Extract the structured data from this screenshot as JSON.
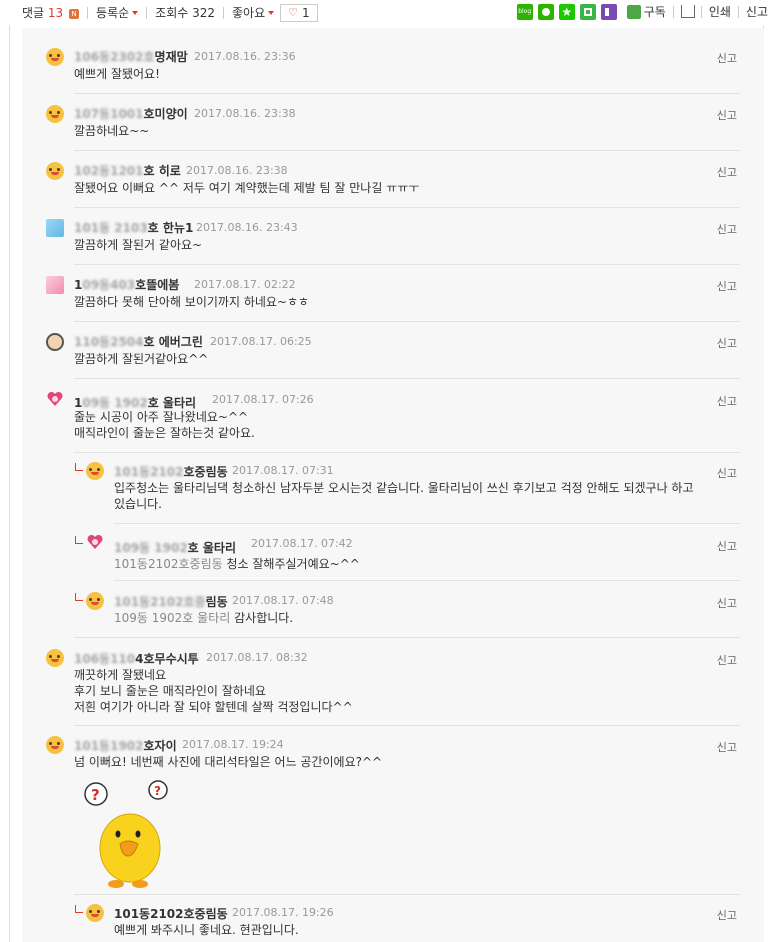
{
  "toolbar": {
    "comments_label": "댓글",
    "comments_count": "13",
    "comments_badge": "N",
    "sort_label": "등록순",
    "views_label": "조회수 322",
    "like_label": "좋아요",
    "like_count": "1",
    "subscribe_label": "구독",
    "print_label": "인쇄",
    "report_label": "신고",
    "share_icons": [
      "blog-icon",
      "band-icon",
      "star-icon",
      "square-icon",
      "pin-icon"
    ]
  },
  "comments": [
    {
      "name_blur": "106동2302호",
      "name": "명재맘",
      "date": "2017.08.16. 23:36",
      "report": "신고",
      "lines": [
        "예쁘게 잘됐어요!"
      ]
    },
    {
      "name_blur": "107동1001",
      "name": "호미양이",
      "date": "2017.08.16. 23:38",
      "report": "신고",
      "lines": [
        "깔끔하네요~~"
      ]
    },
    {
      "name_blur": "102동1201",
      "name": "호 히로",
      "date": "2017.08.16. 23:38",
      "report": "신고",
      "lines": [
        "잘됐어요 이뻐요 ^^ 저두 여기 계약했는데 제발 팀 잘 만나길 ㅠㅠㅜ"
      ]
    },
    {
      "name_blur": "101동 2103",
      "name": "호 한뉴1",
      "date": "2017.08.16. 23:43",
      "report": "신고",
      "lines": [
        "깔끔하게 잘된거 같아요~"
      ]
    },
    {
      "name_blur": "1",
      "name_blur2": "09동403",
      "name": "호뜰에봄",
      "date": "2017.08.17. 02:22",
      "report": "신고",
      "lines": [
        "깔끔하다 못해 단아해 보이기까지 하네요~ㅎㅎ"
      ]
    },
    {
      "name_blur": "110동2504",
      "name": "호 에버그린",
      "date": "2017.08.17. 06:25",
      "report": "신고",
      "lines": [
        "깔끔하게 잘된거같아요^^"
      ]
    },
    {
      "name_blur": "1",
      "name_blur2": "09동 1902",
      "name": "호 울타리",
      "date": "2017.08.17. 07:26",
      "report": "신고",
      "lines": [
        "줄눈 시공이 아주 잘나왔네요~^^",
        "매직라인이 줄눈은 잘하는것 같아요."
      ]
    },
    {
      "name_blur": "101동2102",
      "name": "호중림동",
      "date": "2017.08.17. 07:31",
      "report": "신고",
      "lines": [
        "입주청소는 울타리님댁 청소하신 남자두분 오시는것 같습니다. 울타리님이 쓰신 후기보고 걱정 안해도 되겠구나 하고",
        "있습니다."
      ]
    },
    {
      "name_blur": "109동 1902",
      "name": "호 울타리",
      "date": "2017.08.17. 07:42",
      "report": "신고",
      "ref": "101동2102호중림동",
      "lines": [
        "청소 잘해주실거예요~^^"
      ]
    },
    {
      "name_blur": "101동2102호중",
      "name": "림동",
      "date": "2017.08.17. 07:48",
      "report": "신고",
      "ref": "109동 1902호 울타리",
      "lines": [
        "감사합니다."
      ]
    },
    {
      "name_blur": "106동110",
      "name": "4호무수시투",
      "date": "2017.08.17. 08:32",
      "report": "신고",
      "lines": [
        "깨끗하게 잘됐네요",
        "후기 보니 줄눈은 매직라인이 잘하네요",
        "저흰 여기가 아니라 잘 되야 할텐데 살짝 걱정입니다^^"
      ]
    },
    {
      "name_blur": "101동1902",
      "name": "호자이",
      "date": "2017.08.17. 19:24",
      "report": "신고",
      "lines": [
        "넘 이뻐요! 네번째 사진에 대리석타일은 어느 공간이에요?^^"
      ]
    },
    {
      "name_blur": "",
      "name": "101동2102호중림동",
      "date": "2017.08.17. 19:26",
      "report": "신고",
      "lines": [
        "예쁘게 봐주시니 좋네요. 현관입니다."
      ]
    }
  ]
}
